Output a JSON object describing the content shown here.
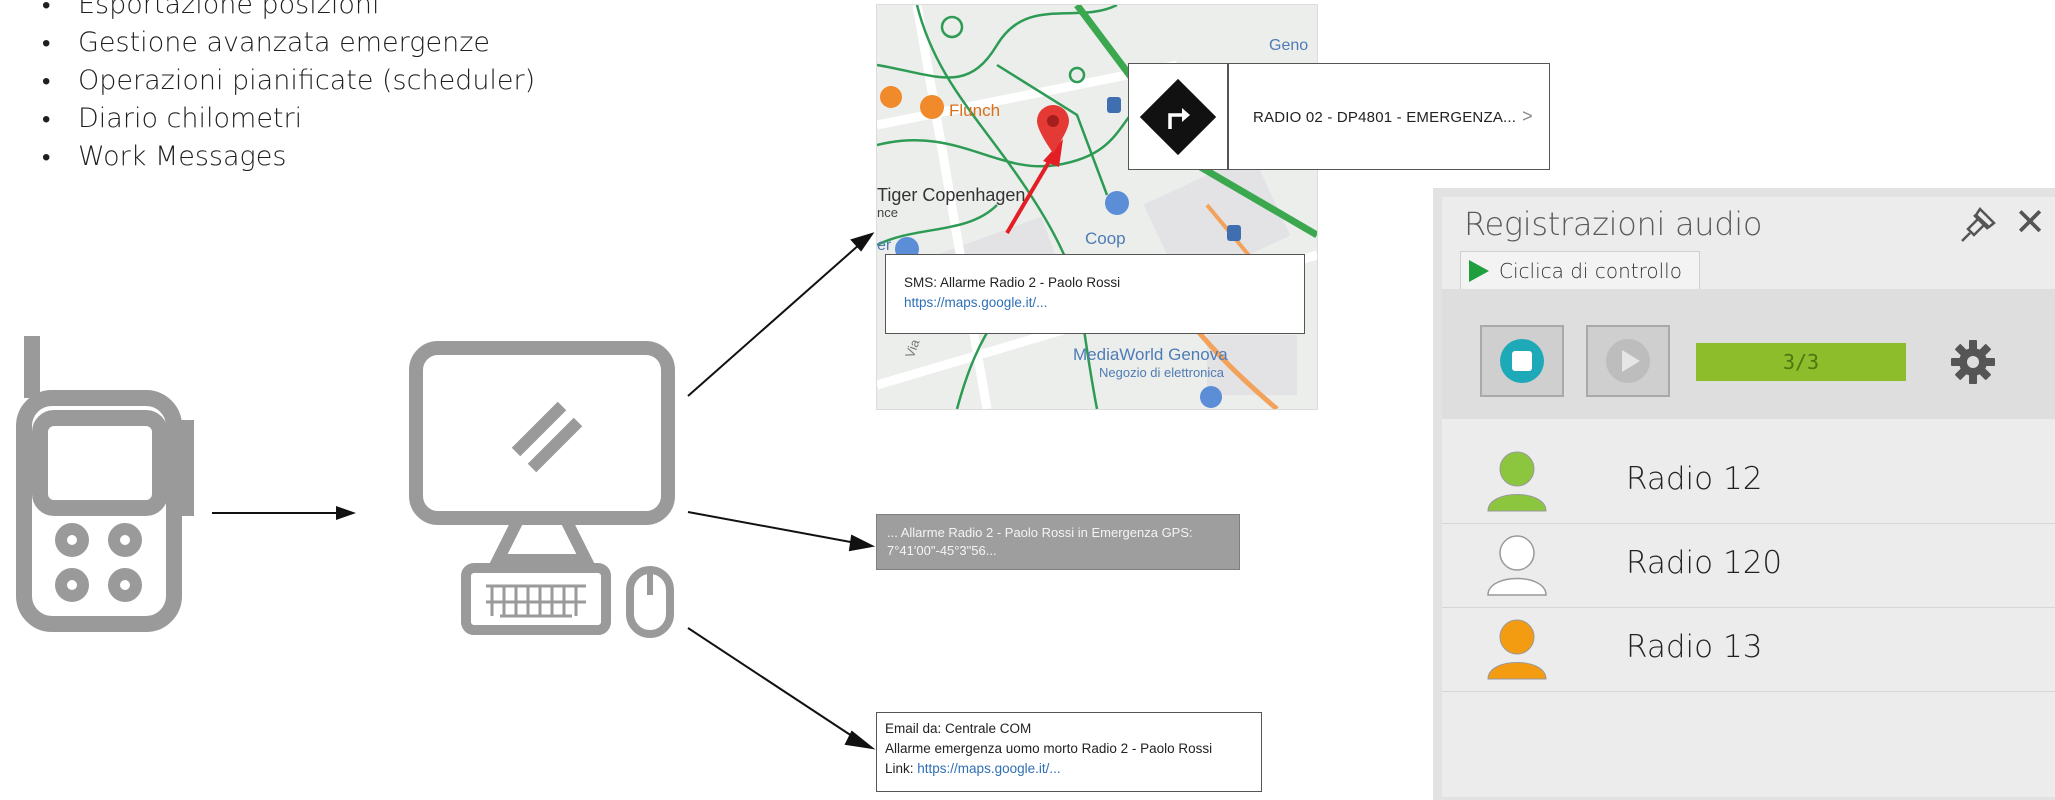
{
  "bullets": [
    "Esportazione posizioni",
    "Gestione avanzata emergenze",
    "Operazioni pianificate (scheduler)",
    "Diario chilometri",
    "Work Messages"
  ],
  "map": {
    "labels": {
      "genova_partial": "Geno",
      "flunch": "Flunch",
      "tiger": "Tiger Copenhagen",
      "nce": "nce",
      "er": "er",
      "coop": "Coop",
      "mediaworld": "MediaWorld Genova",
      "negozio": "Negozio di elettronica",
      "via": "Via"
    }
  },
  "nav_popup": {
    "text": "RADIO 02 - DP4801 - EMERGENZA...",
    "chevron": ">"
  },
  "sms": {
    "line1": "SMS: Allarme Radio 2 - Paolo Rossi",
    "link": "https://maps.google.it/..."
  },
  "gps": {
    "text": "... Allarme Radio 2 - Paolo Rossi in Emergenza GPS: 7°41'00\"-45°3\"56..."
  },
  "email": {
    "line1": "Email da: Centrale COM",
    "line2": "Allarme emergenza uomo morto Radio 2 - Paolo Rossi",
    "link_label": "Link: ",
    "link": "https://maps.google.it/..."
  },
  "audio_panel": {
    "title": "Registrazioni audio",
    "tab": "Ciclica di controllo",
    "progress": "3/3",
    "progress_fraction": 1.0,
    "radios": [
      {
        "label": "Radio 12",
        "color": "#8cc63f"
      },
      {
        "label": "Radio 120",
        "color": "#ffffff"
      },
      {
        "label": "Radio 13",
        "color": "#f39c12"
      }
    ]
  },
  "colors": {
    "stop_teal": "#1ea9b8",
    "play_gray": "#bdbdbd",
    "progress_green": "#8dbd2a",
    "marker_red": "#e53935"
  }
}
